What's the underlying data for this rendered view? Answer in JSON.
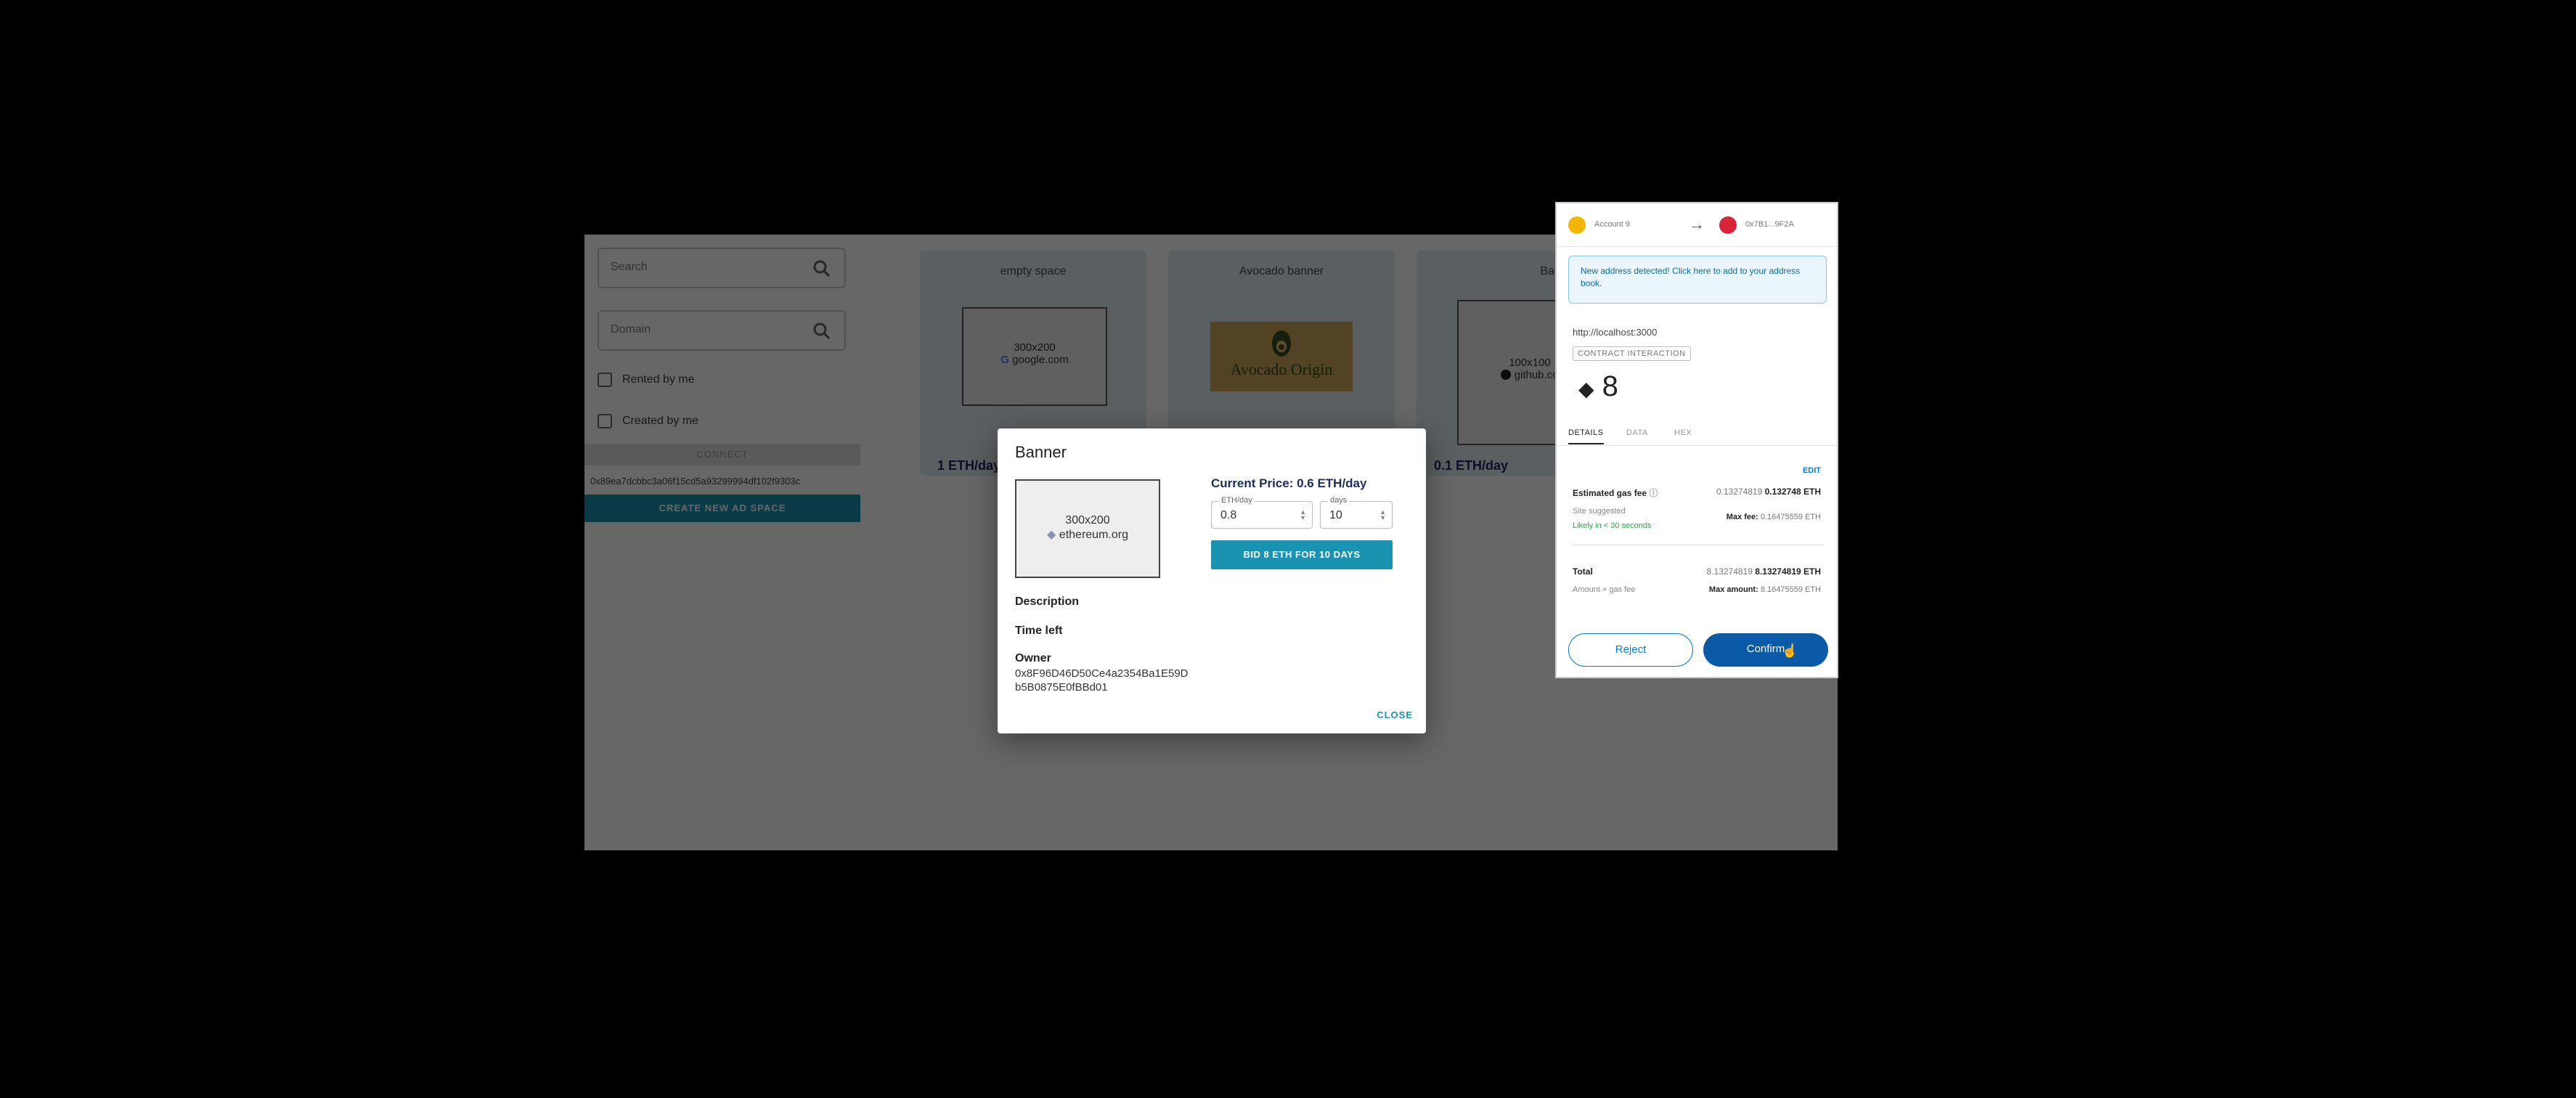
{
  "sidebar": {
    "search_placeholder": "Search",
    "domain_placeholder": "Domain",
    "rented_label": "Rented by me",
    "created_label": "Created by me",
    "connect_label": "CONNECT",
    "address": "0x89ea7dcbbc3a06f15cd5a93299994df102f9303c",
    "create_label": "CREATE NEW AD SPACE"
  },
  "cards": [
    {
      "title": "empty space",
      "size": "300x200",
      "domain": "google.com",
      "price": "1 ETH/day"
    },
    {
      "title": "Avocado banner",
      "banner_text": "Avocado Origin"
    },
    {
      "title": "Banner",
      "size": "100x100",
      "domain": "github.co",
      "price": "0.1 ETH/day"
    }
  ],
  "dialog": {
    "title": "Banner",
    "image_size": "300x200",
    "image_domain": "ethereum.org",
    "current_price": "Current Price: 0.6 ETH/day",
    "eth_label": "ETH/day",
    "eth_value": "0.8",
    "days_label": "days",
    "days_value": "10",
    "bid_label": "BID 8 ETH FOR 10 DAYS",
    "description_label": "Description",
    "time_left_label": "Time left",
    "owner_label": "Owner",
    "owner_line1": "0x8F96D46D50Ce4a2354Ba1E59D",
    "owner_line2": "b5B0875E0fBBd01",
    "close_label": "CLOSE"
  },
  "metamask": {
    "account_from": "Account 9",
    "account_to": "0x7B1...9F2A",
    "notice": "New address detected! Click here to add to your address book.",
    "origin": "http://localhost:3000",
    "tag": "CONTRACT INTERACTION",
    "amount": "8",
    "tabs": [
      "DETAILS",
      "DATA",
      "HEX"
    ],
    "edit": "EDIT",
    "gas_label": "Estimated gas fee",
    "gas_small": "0.13274819",
    "gas_value": "0.132748 ETH",
    "site_suggested": "Site suggested",
    "likely": "Likely in < 30 seconds",
    "max_fee_label": "Max fee:",
    "max_fee_value": "0.16475559 ETH",
    "total_label": "Total",
    "total_small": "8.13274819",
    "total_value": "8.13274819 ETH",
    "amount_gas": "Amount + gas fee",
    "max_amount_label": "Max amount:",
    "max_amount_value": "8.16475559 ETH",
    "reject": "Reject",
    "confirm": "Confirm",
    "colors": {
      "primary": "#037dd6",
      "confirm_bg": "#0a5aa8"
    }
  }
}
